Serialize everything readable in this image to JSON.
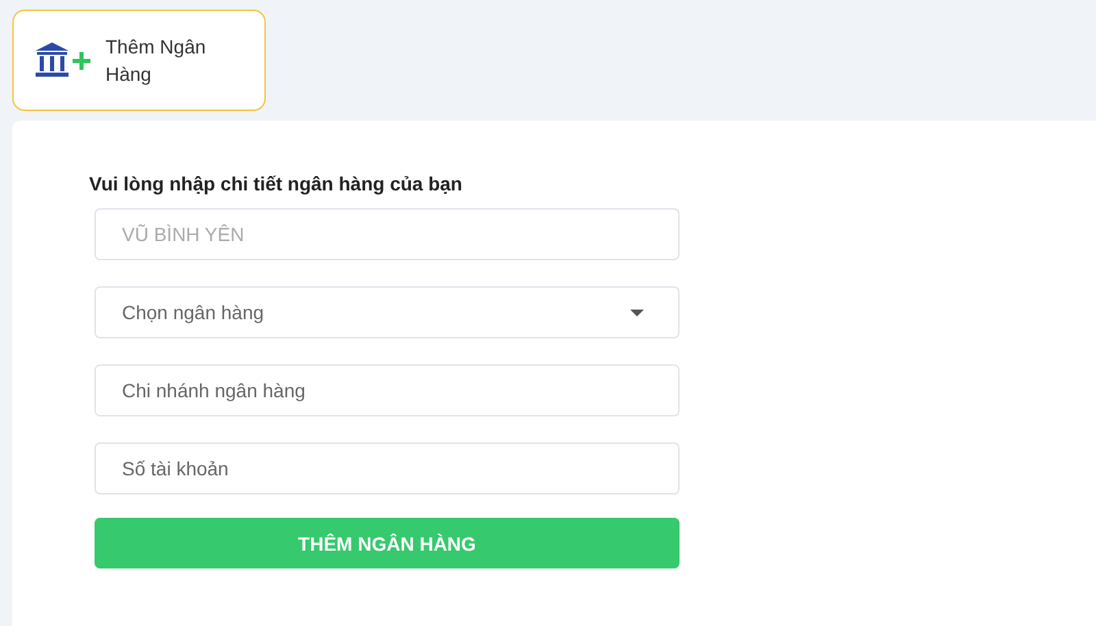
{
  "tab": {
    "label": "Thêm Ngân Hàng",
    "selected": true
  },
  "form": {
    "heading": "Vui lòng nhập chi tiết ngân hàng của bạn",
    "fields": [
      {
        "kind": "text",
        "value": "VŨ BÌNH YÊN",
        "disabled": true
      },
      {
        "kind": "select",
        "placeholder": "Chọn ngân hàng",
        "disabled": false
      },
      {
        "kind": "text",
        "placeholder": "Chi nhánh ngân hàng",
        "disabled": false
      },
      {
        "kind": "text",
        "placeholder": "Số tài khoản",
        "disabled": false
      }
    ],
    "submit": "THÊM NGÂN HÀNG"
  }
}
